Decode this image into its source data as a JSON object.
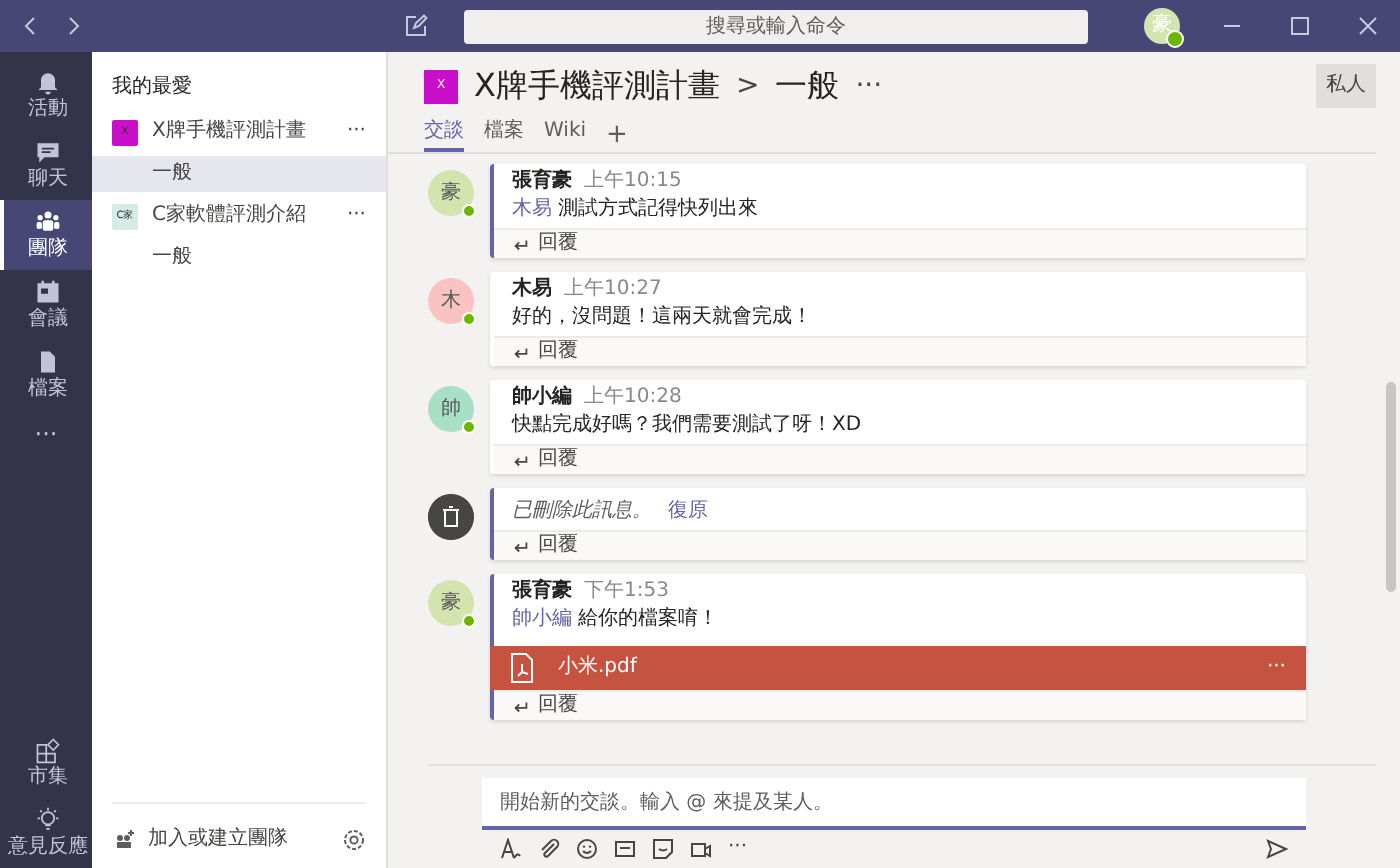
{
  "top_bar": {
    "search": {
      "placeholder": "搜尋或輸入命令"
    },
    "avatar": "豪"
  },
  "rail": [
    {
      "label": "活動",
      "selected": false
    },
    {
      "label": "聊天",
      "selected": false
    },
    {
      "label": "團隊",
      "selected": true
    },
    {
      "label": "會議",
      "selected": false
    },
    {
      "label": "檔案",
      "selected": false
    }
  ],
  "rail_more": "···",
  "rail_bottom": [
    {
      "label": "市集",
      "selected": false
    },
    {
      "label": "意見反應",
      "selected": false
    }
  ],
  "teams_panel": {
    "heading": "我的最愛",
    "teams": [
      {
        "name": "X牌手機評測計畫",
        "tile": "X",
        "color": "#c90fc9",
        "more": "···",
        "channels": [
          {
            "name": "一般",
            "selected": true
          }
        ]
      },
      {
        "name": "C家軟體評測介紹",
        "tile": "C家",
        "color": "#d6ebe6",
        "more": "···",
        "channels": [
          {
            "name": "一般",
            "selected": false
          }
        ]
      }
    ],
    "join": "加入或建立團隊"
  },
  "header": {
    "tile": "X",
    "title": "X牌手機評測計畫",
    "separator": ">",
    "channel": "一般",
    "more": "···",
    "badge": "私人",
    "tabs": [
      {
        "label": "交談",
        "selected": true
      },
      {
        "label": "檔案",
        "selected": false
      },
      {
        "label": "Wiki",
        "selected": false
      }
    ],
    "add_tab": "+"
  },
  "messages": [
    {
      "kind": "message",
      "avatar": "豪",
      "color": "#d3e4ae",
      "author": "張育豪",
      "time": "上午10:15",
      "mention": "木易",
      "text": "測試方式記得快列出來",
      "highlight": true,
      "reply": "回覆"
    },
    {
      "kind": "message",
      "avatar": "木",
      "color": "#f8c3c0",
      "author": "木易",
      "time": "上午10:27",
      "text": "好的，沒問題！這兩天就會完成！",
      "highlight": false,
      "reply": "回覆"
    },
    {
      "kind": "message",
      "avatar": "帥",
      "color": "#a8e0c5",
      "author": "帥小編",
      "time": "上午10:28",
      "text": "快點完成好嗎？我們需要測試了呀！XD",
      "highlight": false,
      "reply": "回覆"
    },
    {
      "kind": "deleted",
      "text": "已刪除此訊息。",
      "undo": "復原",
      "highlight": true,
      "reply": "回覆"
    },
    {
      "kind": "message",
      "avatar": "豪",
      "color": "#d3e4ae",
      "author": "張育豪",
      "time": "下午1:53",
      "mention": "帥小編",
      "text": "給你的檔案唷！",
      "highlight": true,
      "attachment": {
        "name": "小米.pdf",
        "more": "···"
      },
      "reply": "回覆"
    }
  ],
  "composer": {
    "placeholder": "開始新的交談。輸入 @ 來提及某人。",
    "more": "···"
  }
}
